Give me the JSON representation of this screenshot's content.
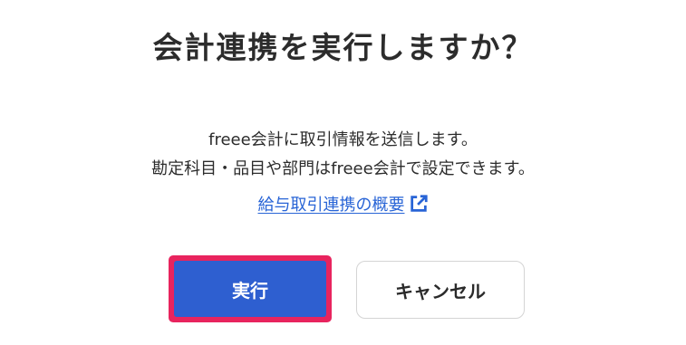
{
  "dialog": {
    "title": "会計連携を実行しますか？",
    "message_line1": "freee会計に取引情報を送信します。",
    "message_line2": "勘定科目・品目や部門はfreee会計で設定できます。",
    "link_label": "給与取引連携の概要",
    "link_icon": "external-link-icon",
    "confirm_label": "実行",
    "cancel_label": "キャンセル"
  },
  "colors": {
    "primary": "#2e5fd0",
    "link": "#2864d6",
    "highlight": "#e8245e"
  }
}
